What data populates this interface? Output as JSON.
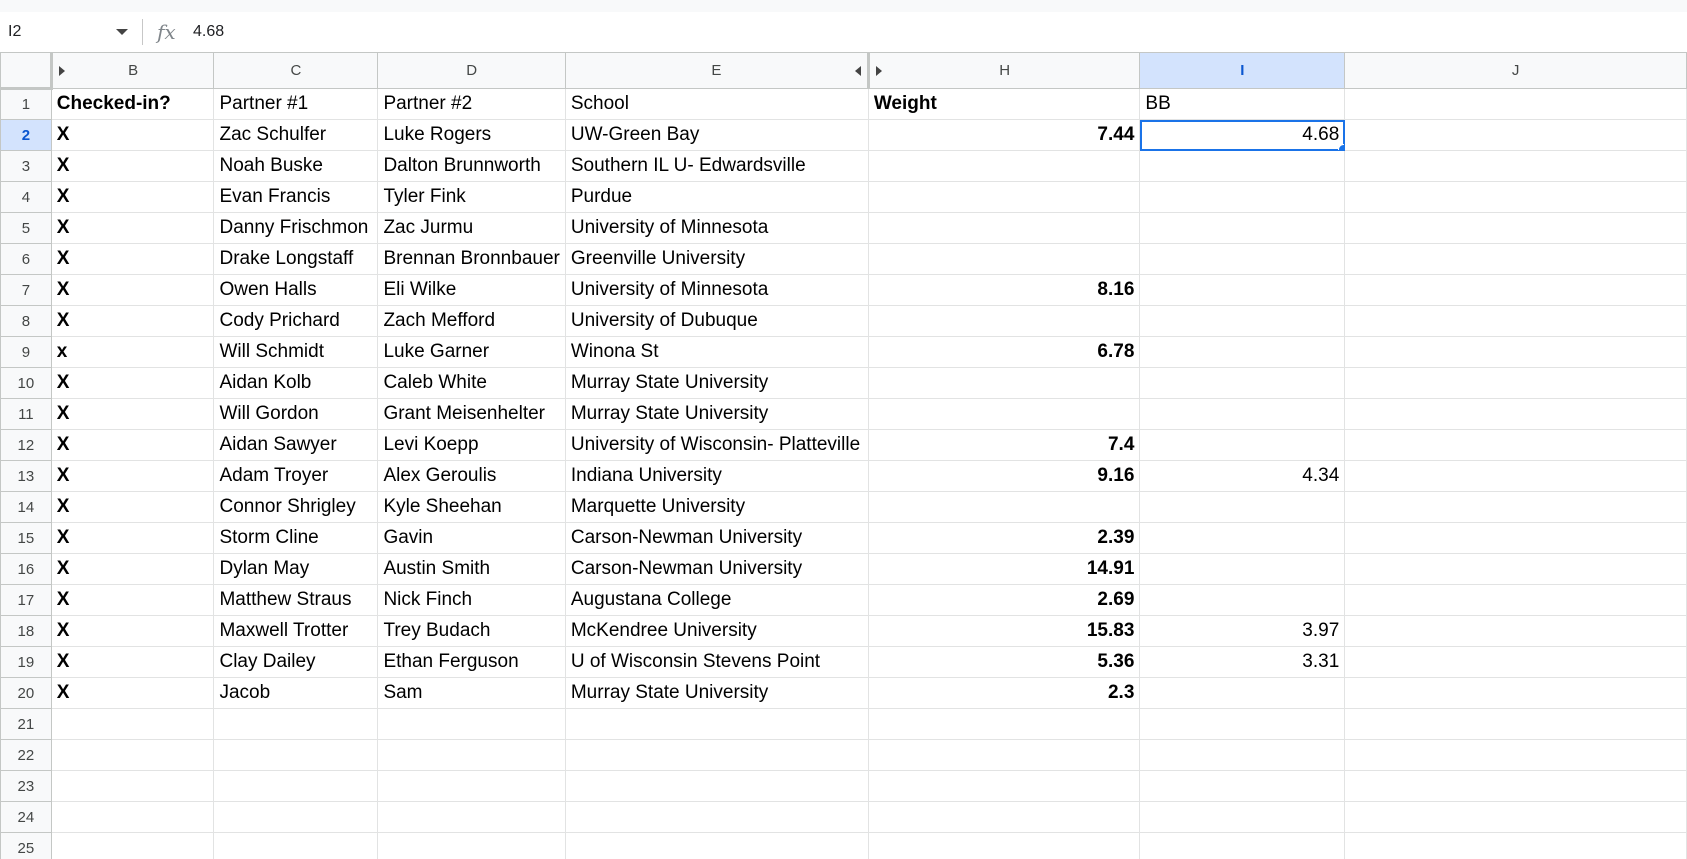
{
  "formula_bar": {
    "cell_ref": "I2",
    "fx_label": "fx",
    "value": "4.68"
  },
  "columns": [
    "B",
    "C",
    "D",
    "E",
    "H",
    "I",
    "J"
  ],
  "selected_column": "I",
  "selected_row": "2",
  "rows": [
    {
      "num": "1",
      "cells": [
        "Checked-in?",
        "Partner #1",
        "Partner #2",
        "School",
        "Weight",
        "BB",
        ""
      ]
    },
    {
      "num": "2",
      "cells": [
        "X",
        "Zac Schulfer",
        "Luke Rogers",
        "UW-Green Bay",
        "7.44",
        "4.68",
        ""
      ]
    },
    {
      "num": "3",
      "cells": [
        "X",
        "Noah Buske",
        "Dalton Brunnworth",
        "Southern IL U- Edwardsville",
        "",
        "",
        ""
      ]
    },
    {
      "num": "4",
      "cells": [
        "X",
        "Evan Francis",
        "Tyler Fink",
        "Purdue",
        "",
        "",
        ""
      ]
    },
    {
      "num": "5",
      "cells": [
        "X",
        "Danny Frischmon",
        "Zac Jurmu",
        "University of Minnesota",
        "",
        "",
        ""
      ]
    },
    {
      "num": "6",
      "cells": [
        "X",
        "Drake Longstaff",
        "Brennan Bronnbauer",
        "Greenville University",
        "",
        "",
        ""
      ]
    },
    {
      "num": "7",
      "cells": [
        "X",
        "Owen Halls",
        "Eli Wilke",
        "University of Minnesota",
        "8.16",
        "",
        ""
      ]
    },
    {
      "num": "8",
      "cells": [
        "X",
        "Cody Prichard",
        "Zach Mefford",
        "University of Dubuque",
        "",
        "",
        ""
      ]
    },
    {
      "num": "9",
      "cells": [
        "x",
        "Will Schmidt",
        "Luke Garner",
        "Winona St",
        "6.78",
        "",
        ""
      ]
    },
    {
      "num": "10",
      "cells": [
        "X",
        "Aidan Kolb",
        "Caleb White",
        " Murray State University",
        "",
        "",
        ""
      ]
    },
    {
      "num": "11",
      "cells": [
        "X",
        "Will Gordon",
        "Grant Meisenhelter",
        "Murray State University",
        "",
        "",
        ""
      ]
    },
    {
      "num": "12",
      "cells": [
        "X",
        "Aidan Sawyer",
        "Levi Koepp",
        "University of Wisconsin- Platteville",
        "7.4",
        "",
        ""
      ]
    },
    {
      "num": "13",
      "cells": [
        "X",
        "Adam Troyer",
        "Alex Geroulis",
        " Indiana University",
        "9.16",
        "4.34",
        ""
      ]
    },
    {
      "num": "14",
      "cells": [
        "X",
        "Connor Shrigley",
        "Kyle Sheehan",
        "Marquette University",
        "",
        "",
        ""
      ]
    },
    {
      "num": "15",
      "cells": [
        "X",
        "Storm Cline",
        "Gavin",
        "Carson-Newman University",
        "2.39",
        "",
        ""
      ]
    },
    {
      "num": "16",
      "cells": [
        "X",
        "Dylan May",
        "Austin Smith",
        "Carson-Newman University",
        "14.91",
        "",
        ""
      ]
    },
    {
      "num": "17",
      "cells": [
        "X",
        "Matthew Straus",
        "Nick Finch",
        "Augustana College",
        "2.69",
        "",
        ""
      ]
    },
    {
      "num": "18",
      "cells": [
        "X",
        "Maxwell Trotter",
        "Trey Budach",
        "McKendree University",
        "15.83",
        "3.97",
        ""
      ]
    },
    {
      "num": "19",
      "cells": [
        "X",
        "Clay Dailey",
        "Ethan Ferguson",
        "U of Wisconsin Stevens Point",
        "5.36",
        "3.31",
        ""
      ]
    },
    {
      "num": "20",
      "cells": [
        "X",
        "Jacob",
        "Sam",
        "Murray State University",
        "2.3",
        "",
        ""
      ]
    },
    {
      "num": "21",
      "cells": [
        "",
        "",
        "",
        "",
        "",
        "",
        ""
      ]
    },
    {
      "num": "22",
      "cells": [
        "",
        "",
        "",
        "",
        "",
        "",
        ""
      ]
    },
    {
      "num": "23",
      "cells": [
        "",
        "",
        "",
        "",
        "",
        "",
        ""
      ]
    },
    {
      "num": "24",
      "cells": [
        "",
        "",
        "",
        "",
        "",
        "",
        ""
      ]
    },
    {
      "num": "25",
      "cells": [
        "",
        "",
        "",
        "",
        "",
        "",
        ""
      ]
    }
  ],
  "colors": {
    "selection": "#1a73e8",
    "header_selected_bg": "#d3e3fd",
    "header_bg": "#f8f9fa",
    "gridline": "#e2e3e3"
  }
}
